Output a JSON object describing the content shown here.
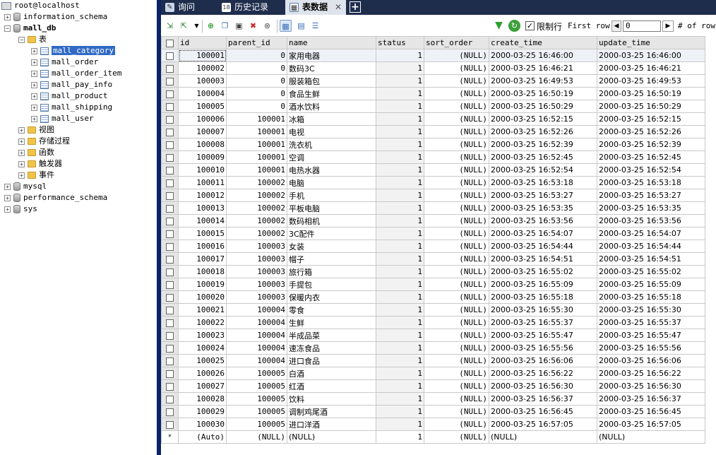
{
  "tree": {
    "root": "root@localhost",
    "databases": [
      {
        "name": "information_schema",
        "expanded": false
      },
      {
        "name": "mall_db",
        "expanded": true
      },
      {
        "name": "mysql",
        "expanded": false
      },
      {
        "name": "performance_schema",
        "expanded": false
      },
      {
        "name": "sys",
        "expanded": false
      }
    ],
    "tables_folder": "表",
    "tables": [
      "mall_category",
      "mall_order",
      "mall_order_item",
      "mall_pay_info",
      "mall_product",
      "mall_shipping",
      "mall_user"
    ],
    "selected_table": "mall_category",
    "other_folders": [
      "视图",
      "存储过程",
      "函数",
      "触发器",
      "事件"
    ]
  },
  "tabs": [
    {
      "label": "询问",
      "icon": "query-icon"
    },
    {
      "label": "历史记录",
      "icon": "history-icon",
      "icon_text": "18"
    },
    {
      "label": "表数据",
      "icon": "table-data-icon",
      "active": true,
      "close": "✕"
    }
  ],
  "tab_add": "+",
  "toolbar": {
    "limit_rows_label": "限制行",
    "limit_rows_checked": "✓",
    "first_row_label": "First row",
    "first_row_value": "0",
    "rows_label": "# of rows",
    "prev_glyph": "◀",
    "next_glyph": "▶",
    "filter_glyph": "▼",
    "refresh_glyph": "↻"
  },
  "grid": {
    "columns": [
      "id",
      "parent_id",
      "name",
      "status",
      "sort_order",
      "create_time",
      "update_time"
    ],
    "rows": [
      [
        "100001",
        "0",
        "家用电器",
        "1",
        "(NULL)",
        "2000-03-25 16:46:00",
        "2000-03-25 16:46:00"
      ],
      [
        "100002",
        "0",
        "数码3C",
        "1",
        "(NULL)",
        "2000-03-25 16:46:21",
        "2000-03-25 16:46:21"
      ],
      [
        "100003",
        "0",
        "服装箱包",
        "1",
        "(NULL)",
        "2000-03-25 16:49:53",
        "2000-03-25 16:49:53"
      ],
      [
        "100004",
        "0",
        "食品生鲜",
        "1",
        "(NULL)",
        "2000-03-25 16:50:19",
        "2000-03-25 16:50:19"
      ],
      [
        "100005",
        "0",
        "酒水饮料",
        "1",
        "(NULL)",
        "2000-03-25 16:50:29",
        "2000-03-25 16:50:29"
      ],
      [
        "100006",
        "100001",
        "冰箱",
        "1",
        "(NULL)",
        "2000-03-25 16:52:15",
        "2000-03-25 16:52:15"
      ],
      [
        "100007",
        "100001",
        "电视",
        "1",
        "(NULL)",
        "2000-03-25 16:52:26",
        "2000-03-25 16:52:26"
      ],
      [
        "100008",
        "100001",
        "洗衣机",
        "1",
        "(NULL)",
        "2000-03-25 16:52:39",
        "2000-03-25 16:52:39"
      ],
      [
        "100009",
        "100001",
        "空调",
        "1",
        "(NULL)",
        "2000-03-25 16:52:45",
        "2000-03-25 16:52:45"
      ],
      [
        "100010",
        "100001",
        "电热水器",
        "1",
        "(NULL)",
        "2000-03-25 16:52:54",
        "2000-03-25 16:52:54"
      ],
      [
        "100011",
        "100002",
        "电脑",
        "1",
        "(NULL)",
        "2000-03-25 16:53:18",
        "2000-03-25 16:53:18"
      ],
      [
        "100012",
        "100002",
        "手机",
        "1",
        "(NULL)",
        "2000-03-25 16:53:27",
        "2000-03-25 16:53:27"
      ],
      [
        "100013",
        "100002",
        "平板电脑",
        "1",
        "(NULL)",
        "2000-03-25 16:53:35",
        "2000-03-25 16:53:35"
      ],
      [
        "100014",
        "100002",
        "数码相机",
        "1",
        "(NULL)",
        "2000-03-25 16:53:56",
        "2000-03-25 16:53:56"
      ],
      [
        "100015",
        "100002",
        "3C配件",
        "1",
        "(NULL)",
        "2000-03-25 16:54:07",
        "2000-03-25 16:54:07"
      ],
      [
        "100016",
        "100003",
        "女装",
        "1",
        "(NULL)",
        "2000-03-25 16:54:44",
        "2000-03-25 16:54:44"
      ],
      [
        "100017",
        "100003",
        "帽子",
        "1",
        "(NULL)",
        "2000-03-25 16:54:51",
        "2000-03-25 16:54:51"
      ],
      [
        "100018",
        "100003",
        "旅行箱",
        "1",
        "(NULL)",
        "2000-03-25 16:55:02",
        "2000-03-25 16:55:02"
      ],
      [
        "100019",
        "100003",
        "手提包",
        "1",
        "(NULL)",
        "2000-03-25 16:55:09",
        "2000-03-25 16:55:09"
      ],
      [
        "100020",
        "100003",
        "保暖内衣",
        "1",
        "(NULL)",
        "2000-03-25 16:55:18",
        "2000-03-25 16:55:18"
      ],
      [
        "100021",
        "100004",
        "零食",
        "1",
        "(NULL)",
        "2000-03-25 16:55:30",
        "2000-03-25 16:55:30"
      ],
      [
        "100022",
        "100004",
        "生鲜",
        "1",
        "(NULL)",
        "2000-03-25 16:55:37",
        "2000-03-25 16:55:37"
      ],
      [
        "100023",
        "100004",
        "半成品菜",
        "1",
        "(NULL)",
        "2000-03-25 16:55:47",
        "2000-03-25 16:55:47"
      ],
      [
        "100024",
        "100004",
        "速冻食品",
        "1",
        "(NULL)",
        "2000-03-25 16:55:56",
        "2000-03-25 16:55:56"
      ],
      [
        "100025",
        "100004",
        "进口食品",
        "1",
        "(NULL)",
        "2000-03-25 16:56:06",
        "2000-03-25 16:56:06"
      ],
      [
        "100026",
        "100005",
        "白酒",
        "1",
        "(NULL)",
        "2000-03-25 16:56:22",
        "2000-03-25 16:56:22"
      ],
      [
        "100027",
        "100005",
        "红酒",
        "1",
        "(NULL)",
        "2000-03-25 16:56:30",
        "2000-03-25 16:56:30"
      ],
      [
        "100028",
        "100005",
        "饮料",
        "1",
        "(NULL)",
        "2000-03-25 16:56:37",
        "2000-03-25 16:56:37"
      ],
      [
        "100029",
        "100005",
        "调制鸡尾酒",
        "1",
        "(NULL)",
        "2000-03-25 16:56:45",
        "2000-03-25 16:56:45"
      ],
      [
        "100030",
        "100005",
        "进口洋酒",
        "1",
        "(NULL)",
        "2000-03-25 16:57:05",
        "2000-03-25 16:57:05"
      ]
    ],
    "new_row": {
      "marker": "*",
      "values": [
        "(Auto)",
        "(NULL)",
        "(NULL)",
        "1",
        "(NULL)",
        "(NULL)",
        "(NULL)"
      ]
    }
  }
}
